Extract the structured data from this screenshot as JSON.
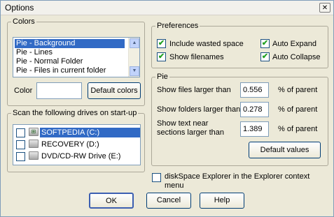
{
  "window": {
    "title": "Options",
    "close_glyph": "✕"
  },
  "colors": {
    "legend": "Colors",
    "list": [
      "Pie - Background",
      "Pie - Lines",
      "Pie - Normal Folder",
      "Pie - Files in current folder"
    ],
    "selected_index": 0,
    "color_label": "Color",
    "color_value": "#ffffff",
    "default_button": "Default colors"
  },
  "drives": {
    "legend": "Scan the following drives on start-up",
    "items": [
      {
        "label": "SOFTPEDIA (C:)",
        "checked": false,
        "selected": true,
        "icon": "windows-drive-icon"
      },
      {
        "label": "RECOVERY (D:)",
        "checked": false,
        "selected": false,
        "icon": "hard-drive-icon"
      },
      {
        "label": "DVD/CD-RW Drive (E:)",
        "checked": false,
        "selected": false,
        "icon": "dvd-drive-icon"
      }
    ]
  },
  "preferences": {
    "legend": "Preferences",
    "include_wasted_space": {
      "label": "Include wasted space",
      "checked": true
    },
    "show_filenames": {
      "label": "Show filenames",
      "checked": true
    },
    "auto_expand": {
      "label": "Auto Expand",
      "checked": true
    },
    "auto_collapse": {
      "label": "Auto Collapse",
      "checked": true
    }
  },
  "pie": {
    "legend": "Pie",
    "files_label": "Show files larger than",
    "files_value": "0.556",
    "folders_label": "Show folders larger than",
    "folders_value": "0.278",
    "text_label_line1": "Show text near",
    "text_label_line2": "sections larger than",
    "text_value": "1.389",
    "unit": "% of parent",
    "default_button": "Default values"
  },
  "context_menu": {
    "label_line1": "diskSpace Explorer in the Explorer context",
    "label_line2": "menu",
    "checked": false
  },
  "buttons": {
    "ok": "OK",
    "cancel": "Cancel",
    "help": "Help"
  },
  "check_glyph": "✔",
  "scroll": {
    "up": "▲",
    "down": "▼"
  }
}
